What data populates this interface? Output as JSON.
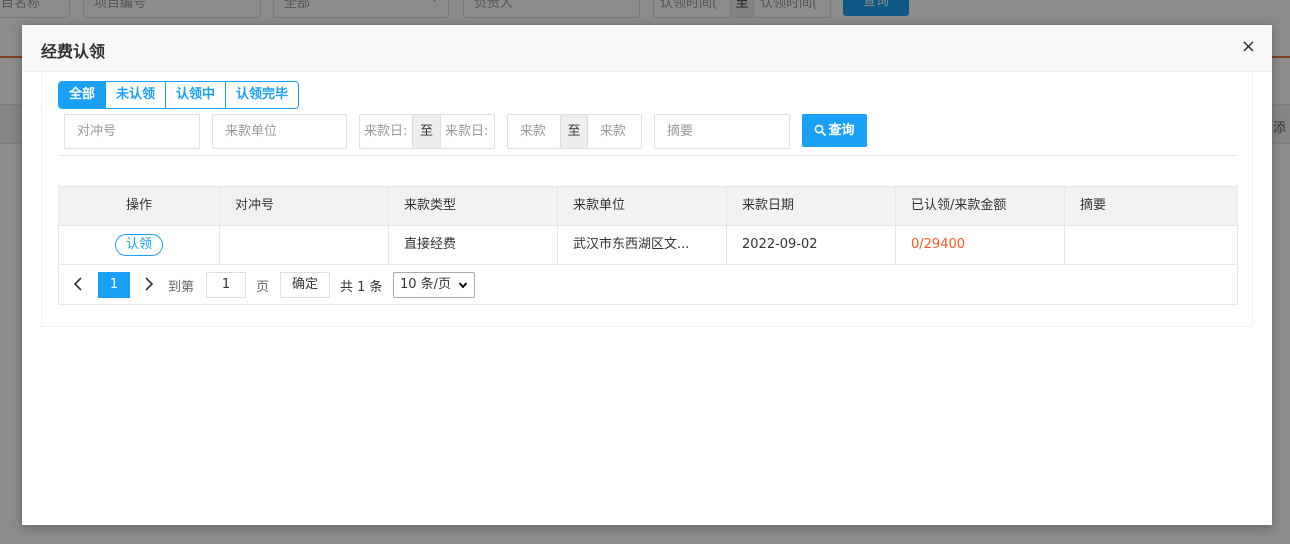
{
  "background": {
    "fields": [
      "目名称",
      "项目编号",
      "全部",
      "负责人",
      "认领时间(",
      "认领时间("
    ],
    "range_separator": "至",
    "search_label": "查询",
    "right_text": "添"
  },
  "modal": {
    "title": "经费认领",
    "close_glyph": "×",
    "tabs": [
      {
        "label": "全部",
        "active": true
      },
      {
        "label": "未认领",
        "active": false
      },
      {
        "label": "认领中",
        "active": false
      },
      {
        "label": "认领完毕",
        "active": false
      }
    ],
    "filters": {
      "offset_no_placeholder": "对冲号",
      "payer_placeholder": "来款单位",
      "date_from_placeholder": "来款日:",
      "date_to_placeholder": "来款日:",
      "date_separator": "至",
      "amount_from_placeholder": "来款",
      "amount_to_placeholder": "来款",
      "amount_separator": "至",
      "summary_placeholder": "摘要",
      "search_label": "查询"
    },
    "table": {
      "headers": [
        "操作",
        "对冲号",
        "来款类型",
        "来款单位",
        "来款日期",
        "已认领/来款金额",
        "摘要"
      ],
      "rows": [
        {
          "action": "认领",
          "offset_no": "",
          "type": "直接经费",
          "payer": "武汉市东西湖区文...",
          "date": "2022-09-02",
          "amount": "0/29400",
          "summary": ""
        }
      ]
    },
    "pager": {
      "prev_glyph": "‹",
      "current_page": "1",
      "next_glyph": "›",
      "goto_label": "到第",
      "goto_value": "1",
      "page_unit": "页",
      "confirm_label": "确定",
      "total_label": "共 1 条",
      "page_size": "10 条/页"
    }
  },
  "colors": {
    "accent": "#1aa1f5",
    "amount_red": "#ff5722",
    "header_orange_line": "#e8763a"
  }
}
